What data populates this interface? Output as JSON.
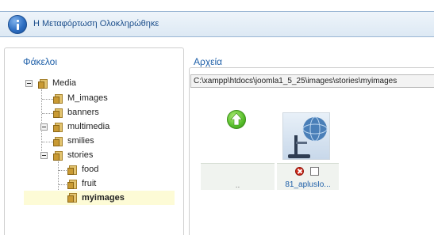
{
  "message": {
    "text": "Η Μεταφόρτωση Ολοκληρώθηκε",
    "icon": "info-icon"
  },
  "folders": {
    "title": "Φάκελοι",
    "tree": [
      {
        "label": "Media",
        "depth": 0,
        "expanded": true
      },
      {
        "label": "M_images",
        "depth": 1
      },
      {
        "label": "banners",
        "depth": 1
      },
      {
        "label": "multimedia",
        "depth": 1,
        "expandable": true
      },
      {
        "label": "smilies",
        "depth": 1
      },
      {
        "label": "stories",
        "depth": 1,
        "expanded": true
      },
      {
        "label": "food",
        "depth": 2
      },
      {
        "label": "fruit",
        "depth": 2
      },
      {
        "label": "myimages",
        "depth": 2,
        "selected": true
      }
    ]
  },
  "files": {
    "title": "Αρχεία",
    "path": "C:\\xampp\\htdocs\\joomla1_5_25\\images\\stories\\myimages",
    "up_label": "..",
    "items": [
      {
        "name": "81_aplusIo..."
      }
    ]
  },
  "colors": {
    "accent": "#1e5fa8",
    "selected_bg": "#fdfbd6",
    "delete": "#d02a1c",
    "up_arrow": "#55bd2a"
  }
}
